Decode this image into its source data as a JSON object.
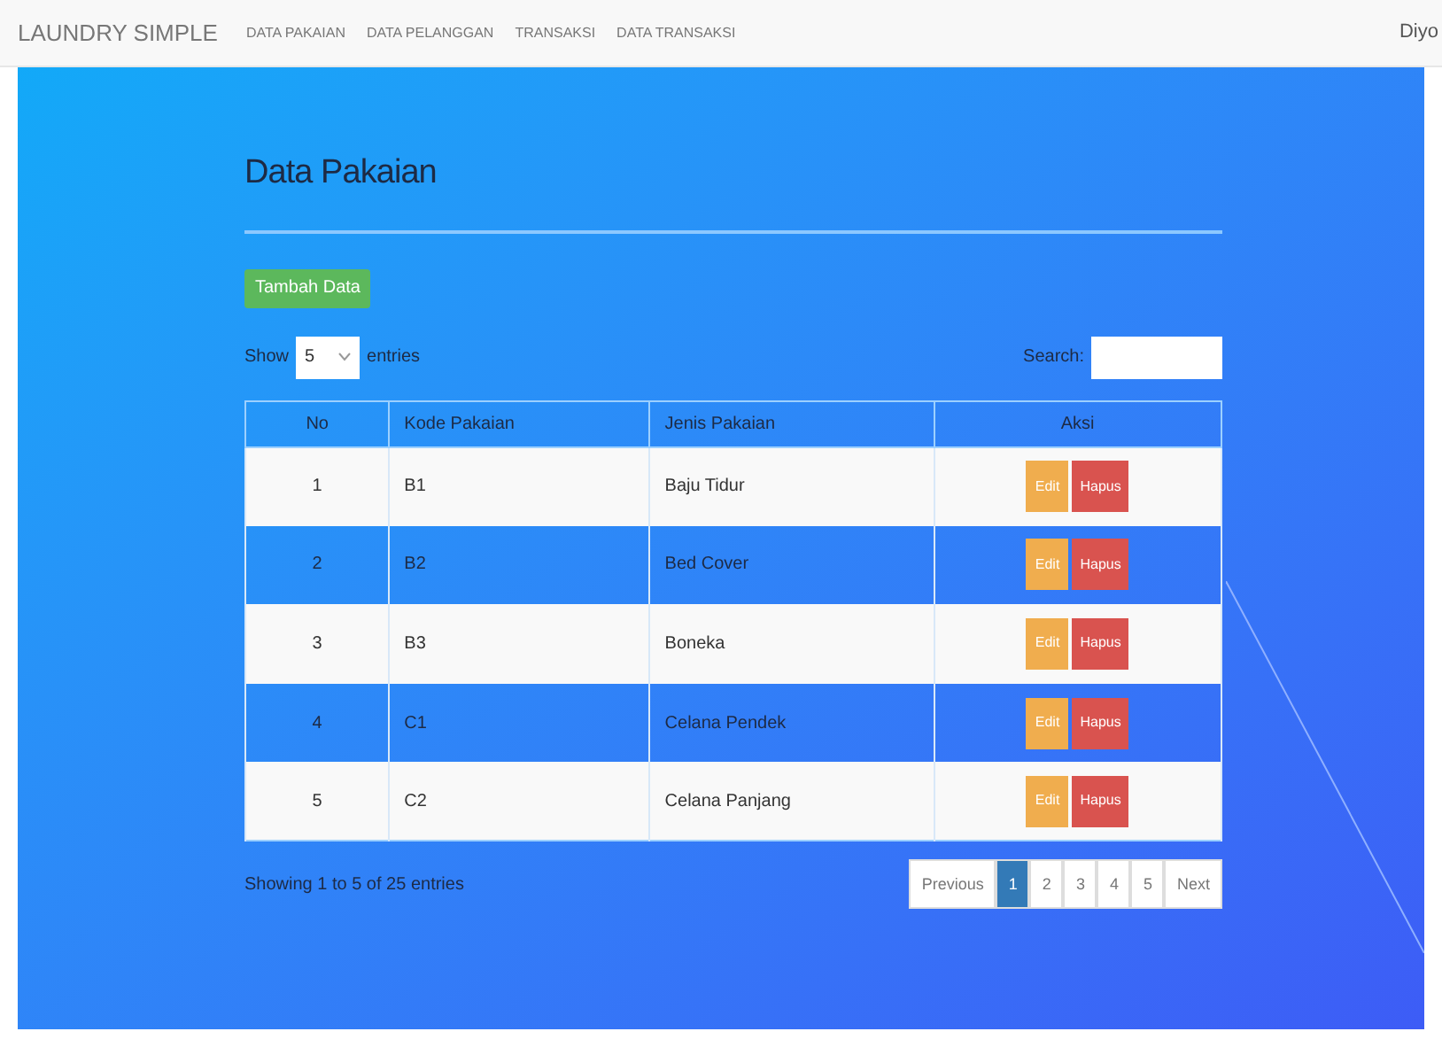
{
  "navbar": {
    "brand": "LAUNDRY SIMPLE",
    "links": [
      "DATA PAKAIAN",
      "DATA PELANGGAN",
      "TRANSAKSI",
      "DATA TRANSAKSI"
    ],
    "user": "Diyo"
  },
  "page": {
    "title": "Data Pakaian",
    "add_button": "Tambah Data"
  },
  "length": {
    "prefix": "Show",
    "value": "5",
    "suffix": "entries"
  },
  "search": {
    "label": "Search:"
  },
  "table": {
    "columns": [
      "No",
      "Kode Pakaian",
      "Jenis Pakaian",
      "Aksi"
    ],
    "rows": [
      {
        "cells": [
          "1",
          "B1",
          "Baju Tidur"
        ],
        "actions": [
          "Edit",
          "Hapus"
        ]
      },
      {
        "cells": [
          "2",
          "B2",
          "Bed Cover"
        ],
        "actions": [
          "Edit",
          "Hapus"
        ]
      },
      {
        "cells": [
          "3",
          "B3",
          "Boneka"
        ],
        "actions": [
          "Edit",
          "Hapus"
        ]
      },
      {
        "cells": [
          "4",
          "C1",
          "Celana Pendek"
        ],
        "actions": [
          "Edit",
          "Hapus"
        ]
      },
      {
        "cells": [
          "5",
          "C2",
          "Celana Panjang"
        ],
        "actions": [
          "Edit",
          "Hapus"
        ]
      }
    ]
  },
  "info": "Showing 1 to 5 of 25 entries",
  "pagination": [
    {
      "label": "Previous",
      "selected": false
    },
    {
      "label": "1",
      "selected": true
    },
    {
      "label": "2",
      "selected": false
    },
    {
      "label": "3",
      "selected": false
    },
    {
      "label": "4",
      "selected": false
    },
    {
      "label": "5",
      "selected": false
    },
    {
      "label": "Next",
      "selected": false
    }
  ]
}
